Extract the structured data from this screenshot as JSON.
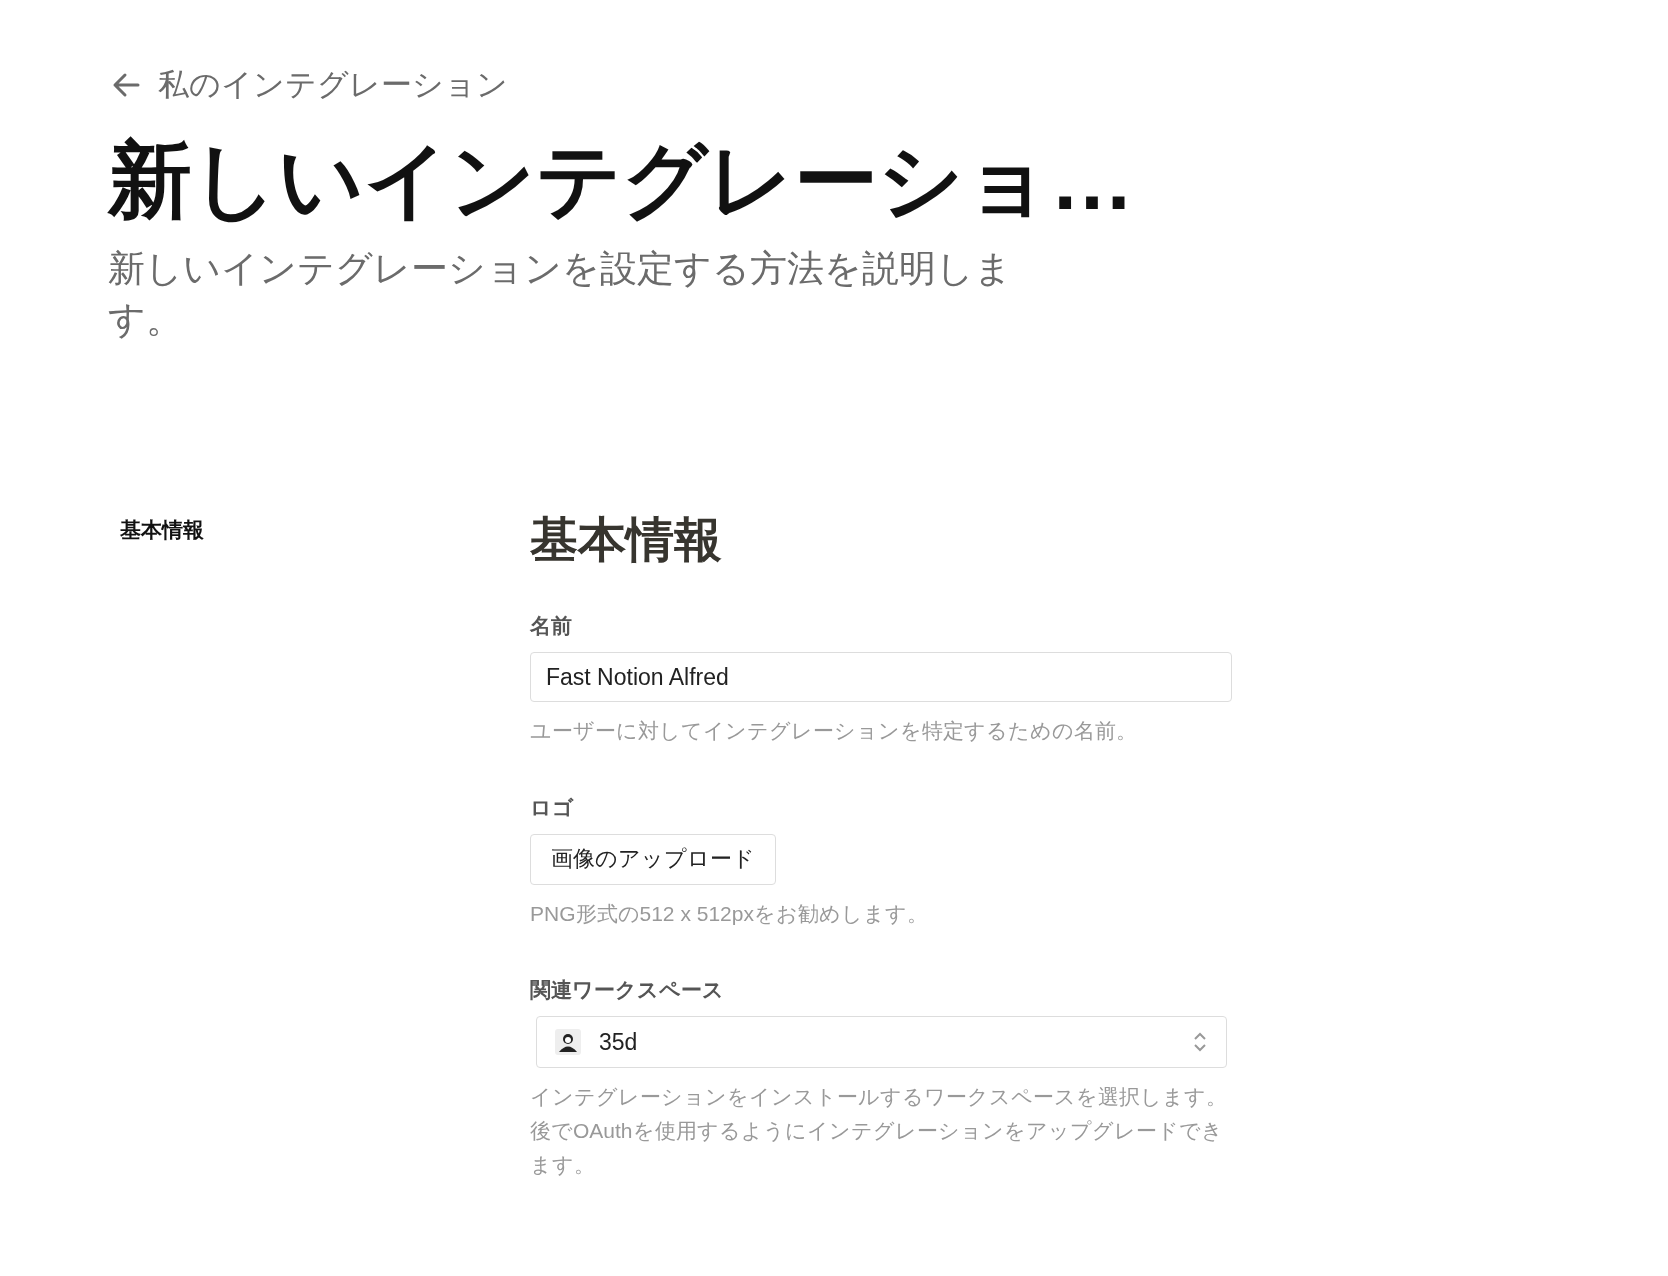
{
  "back_link": {
    "label": "私のインテグレーション"
  },
  "title": "新しいインテグレーショ…",
  "subtitle": "新しいインテグレーションを設定する方法を説明します。",
  "sidebar": {
    "items": [
      {
        "label": "基本情報"
      }
    ]
  },
  "section": {
    "heading": "基本情報",
    "fields": [
      {
        "kind": "text",
        "label": "名前",
        "value": "Fast Notion Alfred",
        "help": "ユーザーに対してインテグレーションを特定するための名前。"
      },
      {
        "kind": "upload",
        "label": "ロゴ",
        "button": "画像のアップロード",
        "help": "PNG形式の512 x 512pxをお勧めします。"
      },
      {
        "kind": "select",
        "label": "関連ワークスペース",
        "value": "35d",
        "help": "インテグレーションをインストールするワークスペースを選択します。後でOAuthを使用するようにインテグレーションをアップグレードできます。"
      }
    ]
  }
}
